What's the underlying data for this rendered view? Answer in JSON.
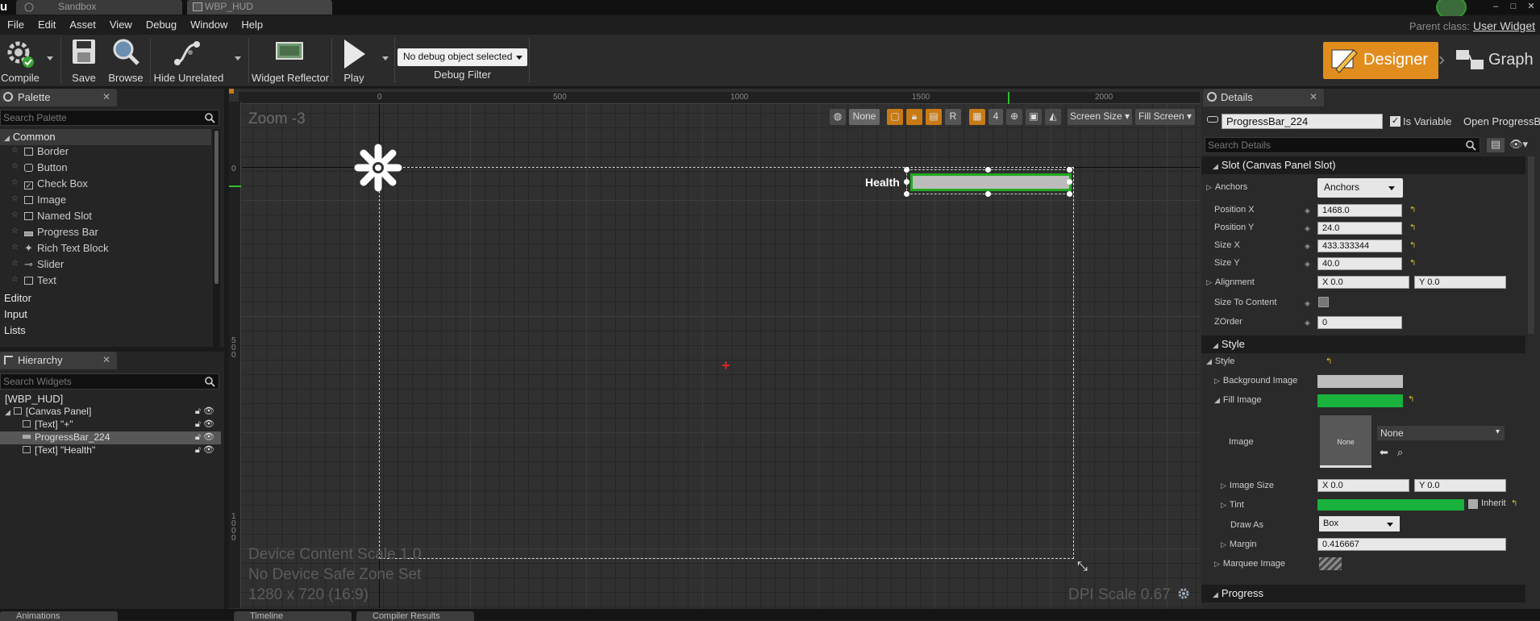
{
  "tabs": {
    "sandbox": "Sandbox",
    "wbp": "WBP_HUD"
  },
  "menu": [
    "File",
    "Edit",
    "Asset",
    "View",
    "Debug",
    "Window",
    "Help"
  ],
  "parent_class": {
    "label": "Parent class:",
    "value": "User Widget"
  },
  "toolbar": {
    "compile": "Compile",
    "save": "Save",
    "browse": "Browse",
    "hide_unrelated": "Hide Unrelated",
    "widget_reflector": "Widget Reflector",
    "play": "Play",
    "debug_select": "No debug object selected",
    "debug_filter": "Debug Filter"
  },
  "modes": {
    "designer": "Designer",
    "graph": "Graph"
  },
  "palette": {
    "tab": "Palette",
    "search_placeholder": "Search Palette",
    "category_common": "Common",
    "items": [
      "Border",
      "Button",
      "Check Box",
      "Image",
      "Named Slot",
      "Progress Bar",
      "Rich Text Block",
      "Slider",
      "Text"
    ],
    "categories": [
      "Editor",
      "Input",
      "Lists"
    ]
  },
  "hierarchy": {
    "tab": "Hierarchy",
    "search_placeholder": "Search Widgets",
    "root": "[WBP_HUD]",
    "canvas": "[Canvas Panel]",
    "items": [
      "[Text] \"+\"",
      "ProgressBar_224",
      "[Text] \"Health\""
    ]
  },
  "viewport": {
    "zoom": "Zoom -3",
    "none_btn": "None",
    "r_btn": "R",
    "grid_num": "4",
    "screen_size": "Screen Size",
    "fill_screen": "Fill Screen",
    "ruler_top": [
      "0",
      "500",
      "1000",
      "1500",
      "2000"
    ],
    "ruler_left": [
      "0",
      "5 0 0",
      "1 0 0 0"
    ],
    "info_scale": "Device Content Scale 1.0",
    "info_safe": "No Device Safe Zone Set",
    "info_res": "1280 x 720 (16:9)",
    "dpi": "DPI Scale 0.67",
    "health_label": "Health",
    "crosshair": "+"
  },
  "details": {
    "tab": "Details",
    "name_value": "ProgressBar_224",
    "is_variable": "Is Variable",
    "open_link": "Open ProgressB",
    "search_placeholder": "Search Details",
    "slot_section": "Slot (Canvas Panel Slot)",
    "anchors_label": "Anchors",
    "anchors_value": "Anchors",
    "position_x_label": "Position X",
    "position_x": "1468.0",
    "position_y_label": "Position Y",
    "position_y": "24.0",
    "size_x_label": "Size X",
    "size_x": "433.333344",
    "size_y_label": "Size Y",
    "size_y": "40.0",
    "alignment_label": "Alignment",
    "align_x": "X  0.0",
    "align_y": "Y  0.0",
    "size_to_content": "Size To Content",
    "zorder_label": "ZOrder",
    "zorder": "0",
    "style_section": "Style",
    "style_label": "Style",
    "bg_image": "Background Image",
    "fill_image": "Fill Image",
    "image_label": "Image",
    "image_thumb": "None",
    "image_select": "None",
    "image_size": "Image Size",
    "img_x": "X  0.0",
    "img_y": "Y  0.0",
    "tint": "Tint",
    "inherit": "Inherit",
    "draw_as": "Draw As",
    "draw_as_value": "Box",
    "margin": "Margin",
    "margin_value": "0.416667",
    "marquee": "Marquee Image",
    "progress_section": "Progress"
  },
  "bottom_tabs": [
    "Animations",
    "Timeline",
    "Compiler Results"
  ],
  "colors": {
    "accent_orange": "#e18d1e",
    "fill_green": "#18b23c",
    "selection_green": "#22a822"
  }
}
